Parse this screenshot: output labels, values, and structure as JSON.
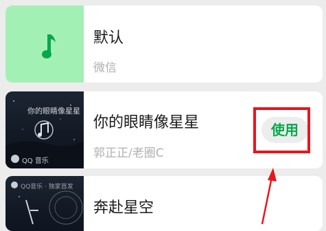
{
  "colors": {
    "accent_green": "#07a84a",
    "annotation_red": "#e8161d",
    "default_cover_bg": "#a3f0b5"
  },
  "items": [
    {
      "title": "默认",
      "subtitle": "微信",
      "cover_icon": "music-note-icon"
    },
    {
      "title": "你的眼睛像星星",
      "subtitle": "郭正正/老圈C",
      "button": "使用",
      "cover_caption": "QQ 音乐",
      "cover_text": "你的眼睛像星星"
    },
    {
      "title": "奔赴星空",
      "cover_caption": "QQ音乐 · 独家首发"
    }
  ]
}
